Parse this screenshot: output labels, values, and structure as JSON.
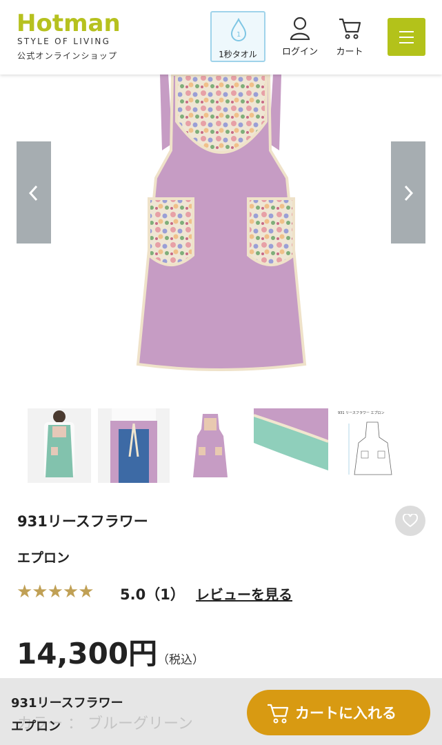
{
  "header": {
    "logo": "Hotman",
    "tagline": "STYLE OF LIVING",
    "subtitle": "公式オンラインショップ",
    "towel_label": "1秒タオル",
    "login_label": "ログイン",
    "cart_label": "カート"
  },
  "product": {
    "name": "931リースフラワー",
    "type": "エプロン",
    "stars": "★★★★★",
    "rating": "5.0（1）",
    "review_link": "レビューを見る",
    "price": "14,300円",
    "tax": "（税込）"
  },
  "thumbnails": [
    {
      "label": "model-front"
    },
    {
      "label": "model-back"
    },
    {
      "label": "apron-flat"
    },
    {
      "label": "fabric-closeup"
    },
    {
      "label": "size-diagram",
      "caption": "931 リースフラワー エプロン"
    }
  ],
  "bottom_bar": {
    "name_line1": "931リースフラワー",
    "name_line2": "エプロン",
    "color_text": "カラー ： ブルーグリーン",
    "cart_button": "カートに入れる"
  },
  "colors": {
    "brand_green": "#b3c21a",
    "cart_orange": "#d89a12",
    "star_gold": "#c0a055",
    "apron_lavender": "#c69cc4"
  }
}
